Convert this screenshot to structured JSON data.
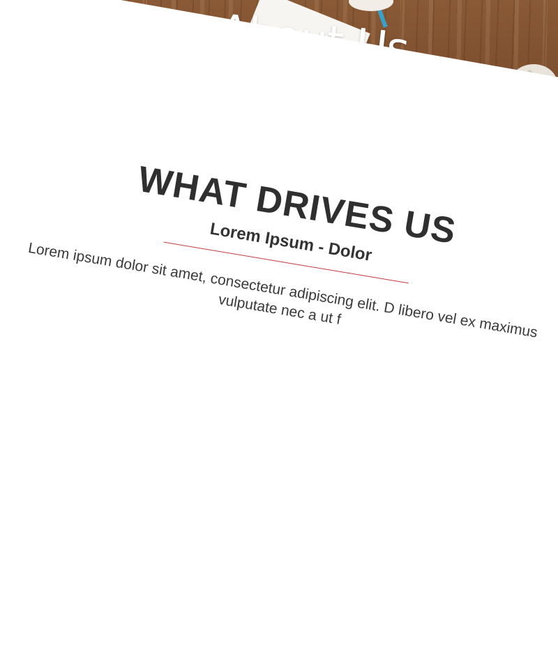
{
  "hero": {
    "title": "About Us"
  },
  "section": {
    "heading": "WHAT DRIVES US",
    "subtitle": "Lorem Ipsum - Dolor",
    "body": "Lorem ipsum dolor sit amet, consectetur adipiscing elit. D libero vel ex maximus vulputate nec a ut f",
    "accent_color": "#c6373f"
  }
}
